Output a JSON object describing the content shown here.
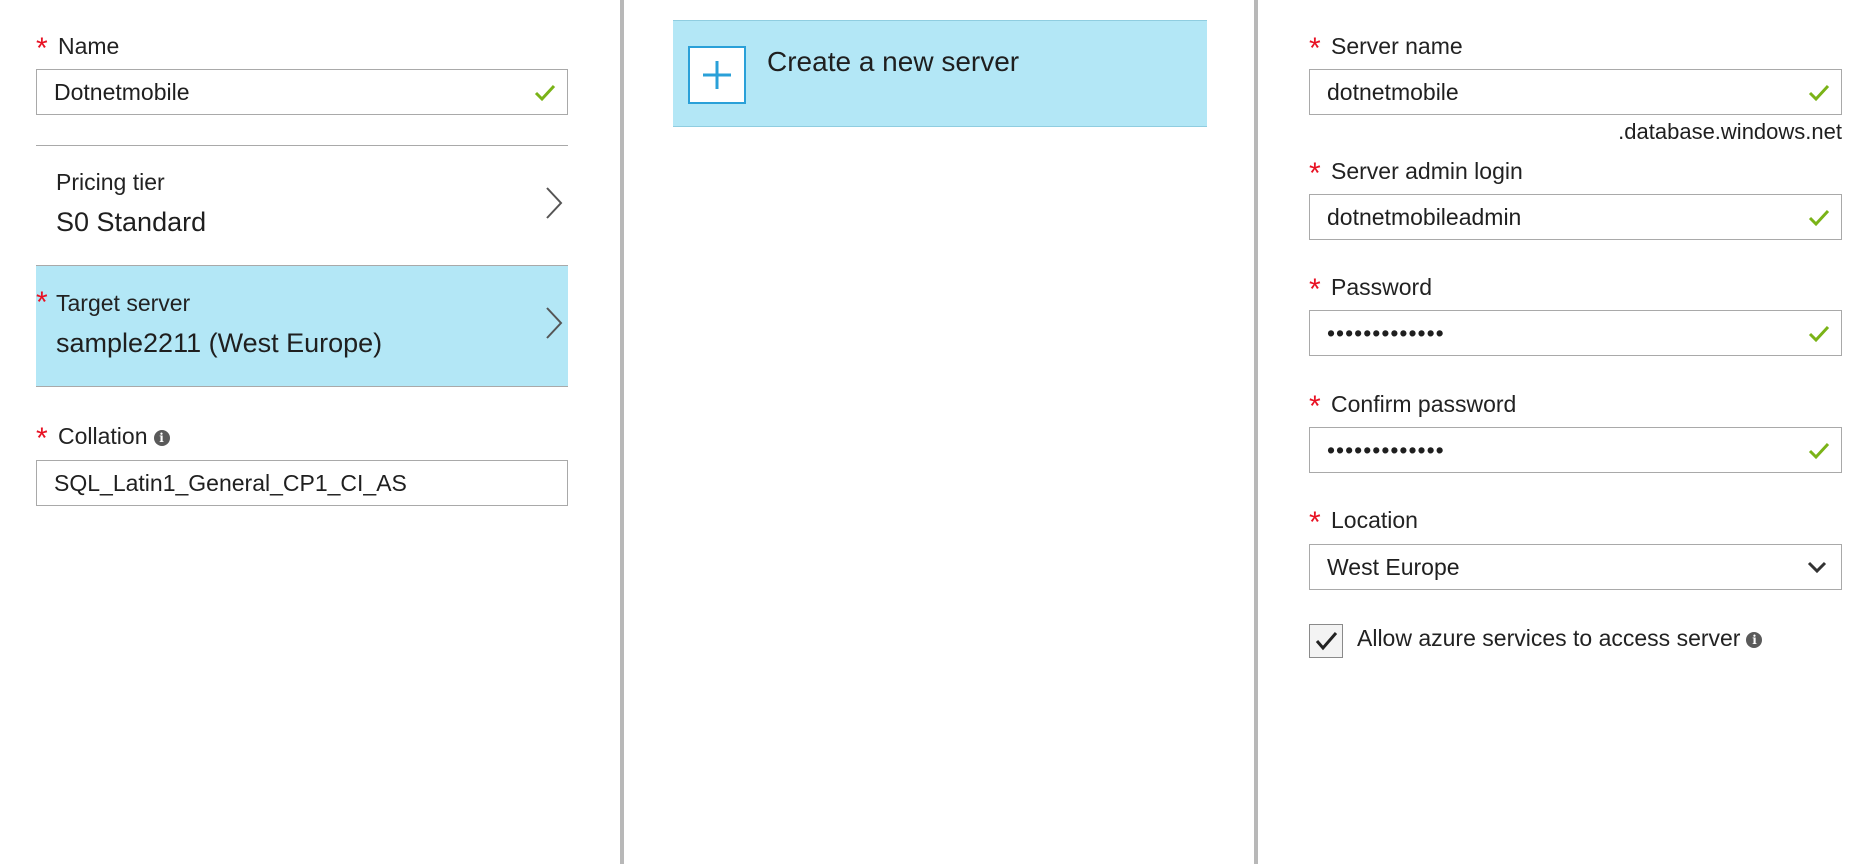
{
  "left_blade": {
    "name": {
      "label": "Name",
      "required_mark": "*",
      "value": "Dotnetmobile"
    },
    "pricing_tier": {
      "label": "Pricing tier",
      "value": "S0 Standard"
    },
    "target_server": {
      "label": "Target server",
      "required_mark": "*",
      "value": "sample2211 (West Europe)"
    },
    "collation": {
      "label": "Collation",
      "required_mark": "*",
      "value": "SQL_Latin1_General_CP1_CI_AS",
      "info_glyph": "i"
    }
  },
  "middle_blade": {
    "create_new_server": {
      "label": "Create a new server",
      "icon": "plus-icon"
    }
  },
  "right_blade": {
    "server_name": {
      "label": "Server name",
      "required_mark": "*",
      "value": "dotnetmobile",
      "suffix": ".database.windows.net"
    },
    "admin_login": {
      "label": "Server admin login",
      "required_mark": "*",
      "value": "dotnetmobileadmin"
    },
    "password": {
      "label": "Password",
      "required_mark": "*",
      "value": "•••••••••••••"
    },
    "confirm_password": {
      "label": "Confirm password",
      "required_mark": "*",
      "value": "•••••••••••••"
    },
    "location": {
      "label": "Location",
      "required_mark": "*",
      "value": "West Europe"
    },
    "allow_azure": {
      "label": "Allow azure services to access server",
      "checked": true,
      "info_glyph": "i"
    }
  },
  "colors": {
    "required": "#e81123",
    "valid_check": "#7ab317",
    "selected_bg": "#b3e7f6",
    "accent_blue": "#2aa0d8",
    "divider": "#b8b8b8"
  }
}
